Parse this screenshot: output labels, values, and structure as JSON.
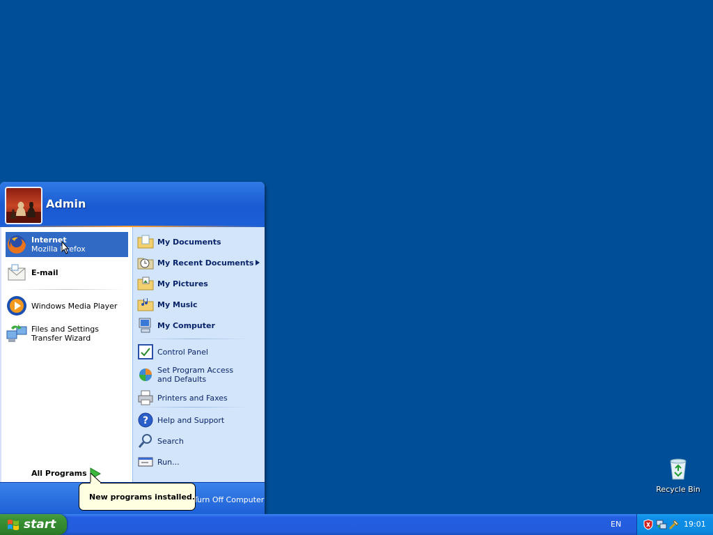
{
  "desktop": {
    "recycle_bin_label": "Recycle Bin"
  },
  "start_menu": {
    "user_name": "Admin",
    "left_items": [
      {
        "title": "Internet",
        "subtitle": "Mozilla Firefox",
        "icon": "firefox-icon",
        "selected": true
      },
      {
        "title": "E-mail",
        "icon": "email-icon"
      },
      {
        "title": "Windows Media Player",
        "icon": "media-player-icon"
      },
      {
        "title": "Files and Settings Transfer Wizard",
        "icon": "transfer-wizard-icon"
      }
    ],
    "all_programs_label": "All Programs",
    "right_items": [
      {
        "label": "My Documents",
        "icon": "folder-documents-icon"
      },
      {
        "label": "My Recent Documents",
        "icon": "recent-documents-icon",
        "submenu": true
      },
      {
        "label": "My Pictures",
        "icon": "folder-pictures-icon"
      },
      {
        "label": "My Music",
        "icon": "folder-music-icon"
      },
      {
        "label": "My Computer",
        "icon": "computer-icon"
      },
      {
        "label": "Control Panel",
        "icon": "control-panel-icon"
      },
      {
        "label": "Set Program Access and Defaults",
        "icon": "program-access-icon"
      },
      {
        "label": "Printers and Faxes",
        "icon": "printer-icon"
      },
      {
        "label": "Help and Support",
        "icon": "help-icon"
      },
      {
        "label": "Search",
        "icon": "search-icon"
      },
      {
        "label": "Run...",
        "icon": "run-icon"
      }
    ],
    "turn_off_label": "Turn Off Computer"
  },
  "balloon": {
    "text": "New programs installed."
  },
  "taskbar": {
    "start_label": "start",
    "language": "EN",
    "clock": "19:01",
    "tray_icons": [
      "security-alert-icon",
      "network-icon",
      "tool-icon"
    ]
  }
}
